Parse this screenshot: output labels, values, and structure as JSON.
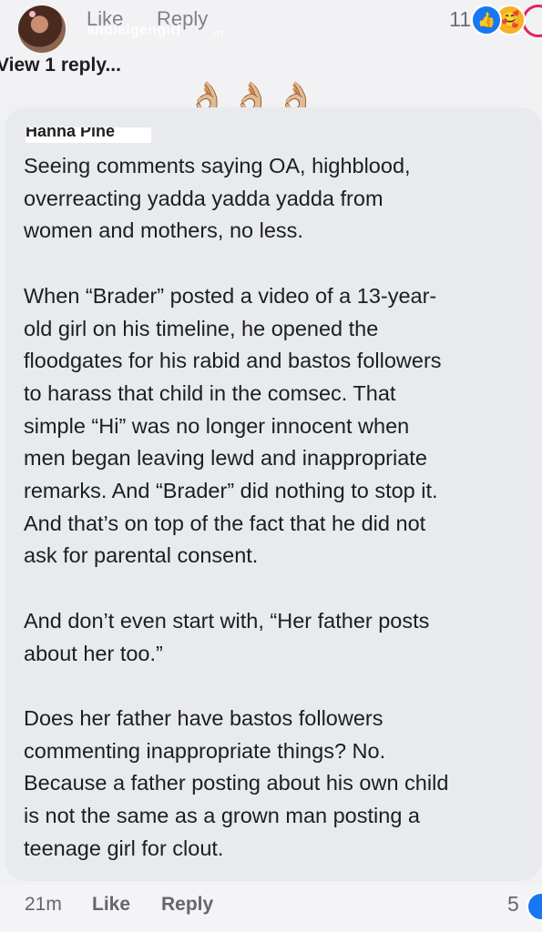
{
  "header": {
    "like_label": "Like",
    "reply_label": "Reply",
    "watermark": "andieigengirl",
    "watermark_suffix": "m",
    "reaction_count": "11",
    "reactions": [
      "like-icon",
      "care-icon",
      "heart-icon"
    ],
    "view_replies": "View 1 reply...",
    "emoji": "👌🏼👌🏼👌🏼"
  },
  "comment": {
    "author_partial": "Hanna Pine",
    "text": "Seeing comments saying OA, highblood,\noverreacting yadda yadda yadda from\nwomen and mothers, no less.\n\nWhen “Brader” posted a video of a 13-year-\nold girl on his timeline, he opened the\nfloodgates for his rabid and bastos followers\nto harass that child in the comsec. That\nsimple “Hi” was no longer innocent when\nmen began leaving lewd and inappropriate\nremarks. And “Brader” did nothing to stop it.\nAnd that’s on top of the fact that he did not\nask for parental consent.\n\nAnd don’t even start with, “Her father posts\nabout her too.”\n\nDoes her father have bastos followers\ncommenting inappropriate things? No.\nBecause a father posting about his own child\nis not the same as a grown man posting a\nteenage girl for clout."
  },
  "footer": {
    "time": "21m",
    "like_label": "Like",
    "reply_label": "Reply",
    "reaction_count": "5"
  },
  "colors": {
    "bubble": "#e9eaed",
    "accent": "#1877f2",
    "muted_text": "#65676b"
  }
}
